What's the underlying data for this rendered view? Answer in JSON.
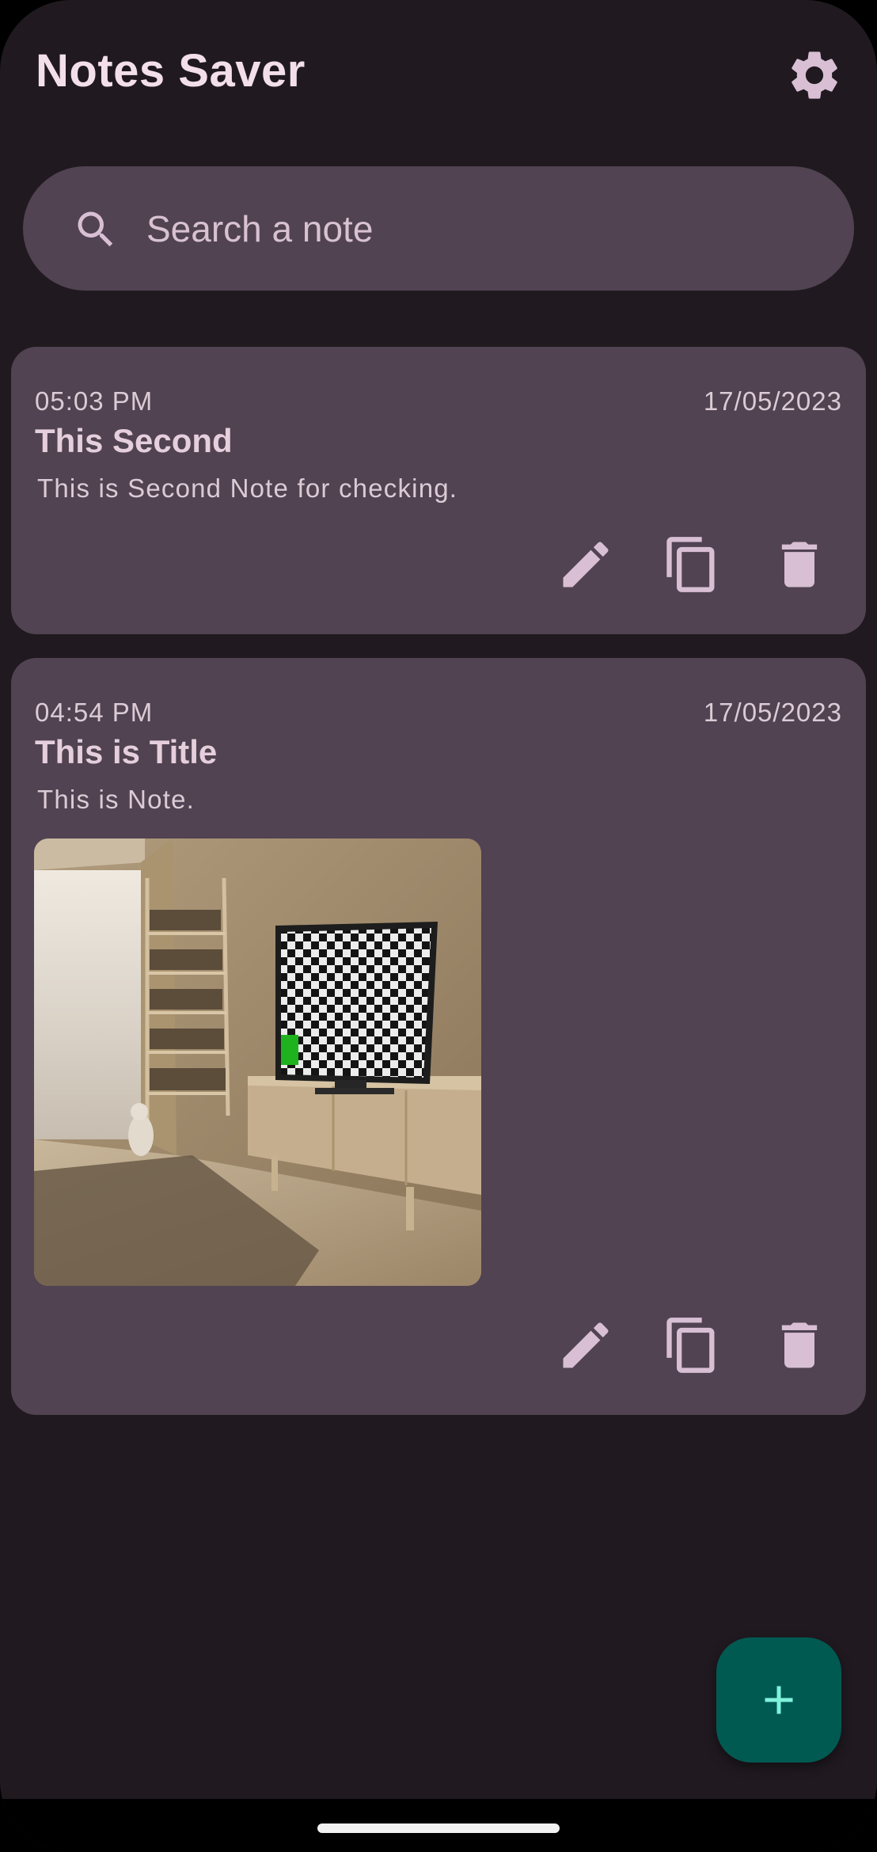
{
  "app": {
    "title": "Notes Saver"
  },
  "search": {
    "placeholder": "Search a note",
    "value": ""
  },
  "notes": [
    {
      "time": "05:03 PM",
      "date": "17/05/2023",
      "title": "This Second",
      "body": "This is Second Note for checking.",
      "has_image": false
    },
    {
      "time": "04:54 PM",
      "date": "17/05/2023",
      "title": "This is Title",
      "body": "This is Note.",
      "has_image": true
    }
  ],
  "icons": {
    "settings": "gear-icon",
    "search": "search-icon",
    "edit": "pencil-icon",
    "copy": "copy-icon",
    "delete": "trash-icon",
    "add": "plus-icon"
  },
  "colors": {
    "background": "#201a20",
    "card": "#514351",
    "title_text": "#f3dfe9",
    "icon_tint": "#d8bfd4",
    "fab": "#015a52",
    "fab_icon": "#7ff2dc"
  }
}
